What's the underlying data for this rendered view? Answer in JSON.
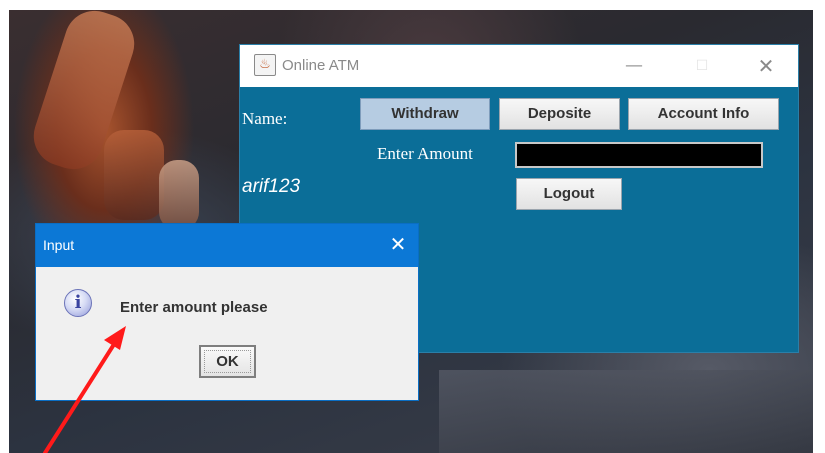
{
  "atm_window": {
    "title": "Online ATM",
    "controls": {
      "minimize": "—",
      "maximize": "☐",
      "close": "✕"
    },
    "name_label": "Name:",
    "username": "arif123",
    "amount_label": "Enter Amount",
    "amount_value": "",
    "buttons": {
      "withdraw": "Withdraw",
      "deposite": "Deposite",
      "account_info": "Account Info",
      "logout": "Logout"
    }
  },
  "dialog": {
    "title": "Input",
    "close": "✕",
    "icon": "info-icon",
    "message": "Enter amount please",
    "ok_label": "OK"
  },
  "annotation": {
    "color": "#ff1a1a"
  },
  "colors": {
    "atm_background": "#0b6e98",
    "dialog_titlebar": "#0c78d6",
    "withdraw_selected": "#b6cce2"
  }
}
